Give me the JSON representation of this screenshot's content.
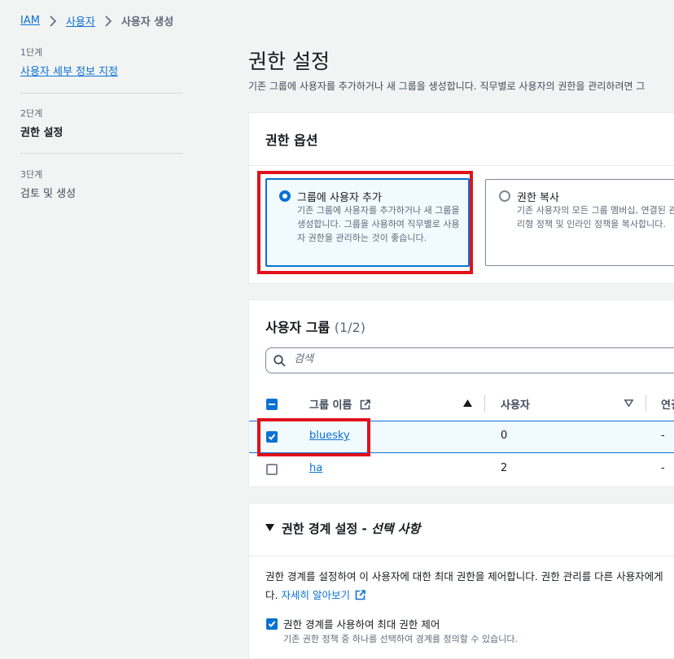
{
  "breadcrumb": {
    "items": [
      "IAM",
      "사용자"
    ],
    "current": "사용자 생성"
  },
  "steps": [
    {
      "num": "1단계",
      "title": "사용자 세부 정보 지정"
    },
    {
      "num": "2단계",
      "title": "권한 설정"
    },
    {
      "num": "3단계",
      "title": "검토 및 생성"
    }
  ],
  "page": {
    "title": "권한 설정",
    "description": "기존 그룹에 사용자를 추가하거나 새 그룹을 생성합니다. 직무별로 사용자의 권한을 관리하려면 그"
  },
  "permission_options": {
    "header": "권한 옵션",
    "options": [
      {
        "title": "그룹에 사용자 추가",
        "desc": "기존 그룹에 사용자를 추가하거나 새 그룹을 생성합니다. 그룹을 사용하여 직무별로 사용자 권한을 관리하는 것이 좋습니다.",
        "selected": true
      },
      {
        "title": "권한 복사",
        "desc": "기존 사용자의 모든 그룹 멤버십, 연결된 관리형 정책 및 인라인 정책을 복사합니다.",
        "selected": false
      }
    ]
  },
  "user_groups": {
    "header": "사용자 그룹",
    "count": "(1/2)",
    "search_placeholder": "검색",
    "columns": [
      "그룹 이름",
      "사용자",
      "연결"
    ],
    "rows": [
      {
        "name": "bluesky",
        "users": "0",
        "attached": "-",
        "checked": true
      },
      {
        "name": "ha",
        "users": "2",
        "attached": "-",
        "checked": false
      }
    ]
  },
  "boundary": {
    "title": "권한 경계 설정 -",
    "title_optional": "선택 사항",
    "desc_line1": "권한 경계를 설정하여 이 사용자에 대한 최대 권한을 제어합니다. 권한 관리를 다른 사용자에게",
    "desc_line2_prefix": "다.",
    "learn_more": "자세히 알아보기",
    "checkbox_label": "권한 경계를 사용하여 최대 권한 제어",
    "checkbox_hint": "기존 권한 정책 중 하나를 선택하여 경계를 정의할 수 있습니다.",
    "checkbox_checked": true
  },
  "colors": {
    "accent": "#0972d3",
    "highlight": "#e0111b",
    "background": "#f2f3f3"
  },
  "icons": [
    "chevron-right-icon",
    "search-icon",
    "external-link-icon",
    "sort-asc-icon",
    "sort-desc-icon",
    "caret-down-icon"
  ]
}
